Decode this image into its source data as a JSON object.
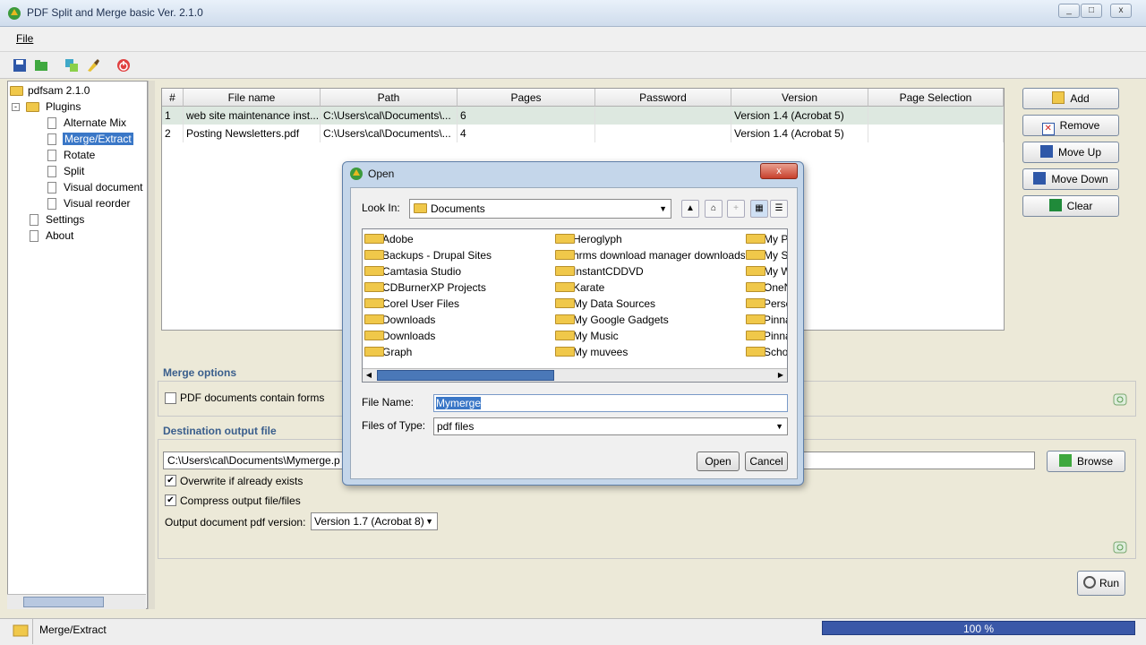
{
  "app": {
    "title": "PDF Split and Merge basic Ver. 2.1.0",
    "min": "_",
    "max": "□",
    "close": "x"
  },
  "menu": {
    "file": "File"
  },
  "tree": {
    "root": "pdfsam 2.1.0",
    "plugins": "Plugins",
    "items": [
      "Alternate Mix",
      "Merge/Extract",
      "Rotate",
      "Split",
      "Visual document",
      "Visual reorder"
    ],
    "settings": "Settings",
    "about": "About"
  },
  "table": {
    "headers": [
      "#",
      "File name",
      "Path",
      "Pages",
      "Password",
      "Version",
      "Page Selection"
    ],
    "rows": [
      [
        "1",
        "web site maintenance inst...",
        "C:\\Users\\cal\\Documents\\...",
        "6",
        "",
        "Version 1.4 (Acrobat 5)",
        ""
      ],
      [
        "2",
        "Posting Newsletters.pdf",
        "C:\\Users\\cal\\Documents\\...",
        "4",
        "",
        "Version 1.4 (Acrobat 5)",
        ""
      ]
    ]
  },
  "sidebuttons": {
    "add": "Add",
    "remove": "Remove",
    "moveup": "Move Up",
    "movedown": "Move Down",
    "clear": "Clear"
  },
  "merge": {
    "title": "Merge options",
    "forms": "PDF documents contain forms"
  },
  "dest": {
    "title": "Destination output file",
    "path": "C:\\Users\\cal\\Documents\\Mymerge.p",
    "browse": "Browse",
    "overwrite": "Overwrite if already exists",
    "compress": "Compress output file/files",
    "version_label": "Output document pdf version:",
    "version": "Version 1.7 (Acrobat 8)",
    "check": "✔"
  },
  "run": "Run",
  "status": {
    "plugin": "Merge/Extract",
    "progress": "100 %"
  },
  "dialog": {
    "title": "Open",
    "close": "x",
    "lookin_label": "Look In:",
    "lookin": "Documents",
    "files_col1": [
      "Adobe",
      "Backups - Drupal Sites",
      "Camtasia Studio",
      "CDBurnerXP Projects",
      "Corel User Files",
      "Downloads",
      "Downloads",
      "Graph"
    ],
    "files_col2": [
      "Heroglyph",
      "hrms download manager downloads",
      "InstantCDDVD",
      "Karate",
      "My Data Sources",
      "My Google Gadgets",
      "My Music",
      "My muvees"
    ],
    "files_col3": [
      "My P",
      "My Sl",
      "My W",
      "OneN",
      "Perso",
      "Pinna",
      "Pinna",
      "Scho"
    ],
    "filename_label": "File Name:",
    "filename": "Mymerge",
    "filetype_label": "Files of Type:",
    "filetype": "pdf files",
    "open": "Open",
    "cancel": "Cancel"
  },
  "colors": {
    "accent": "#3a77c7",
    "progress": "#3a58a8",
    "folder": "#f0c84a"
  }
}
